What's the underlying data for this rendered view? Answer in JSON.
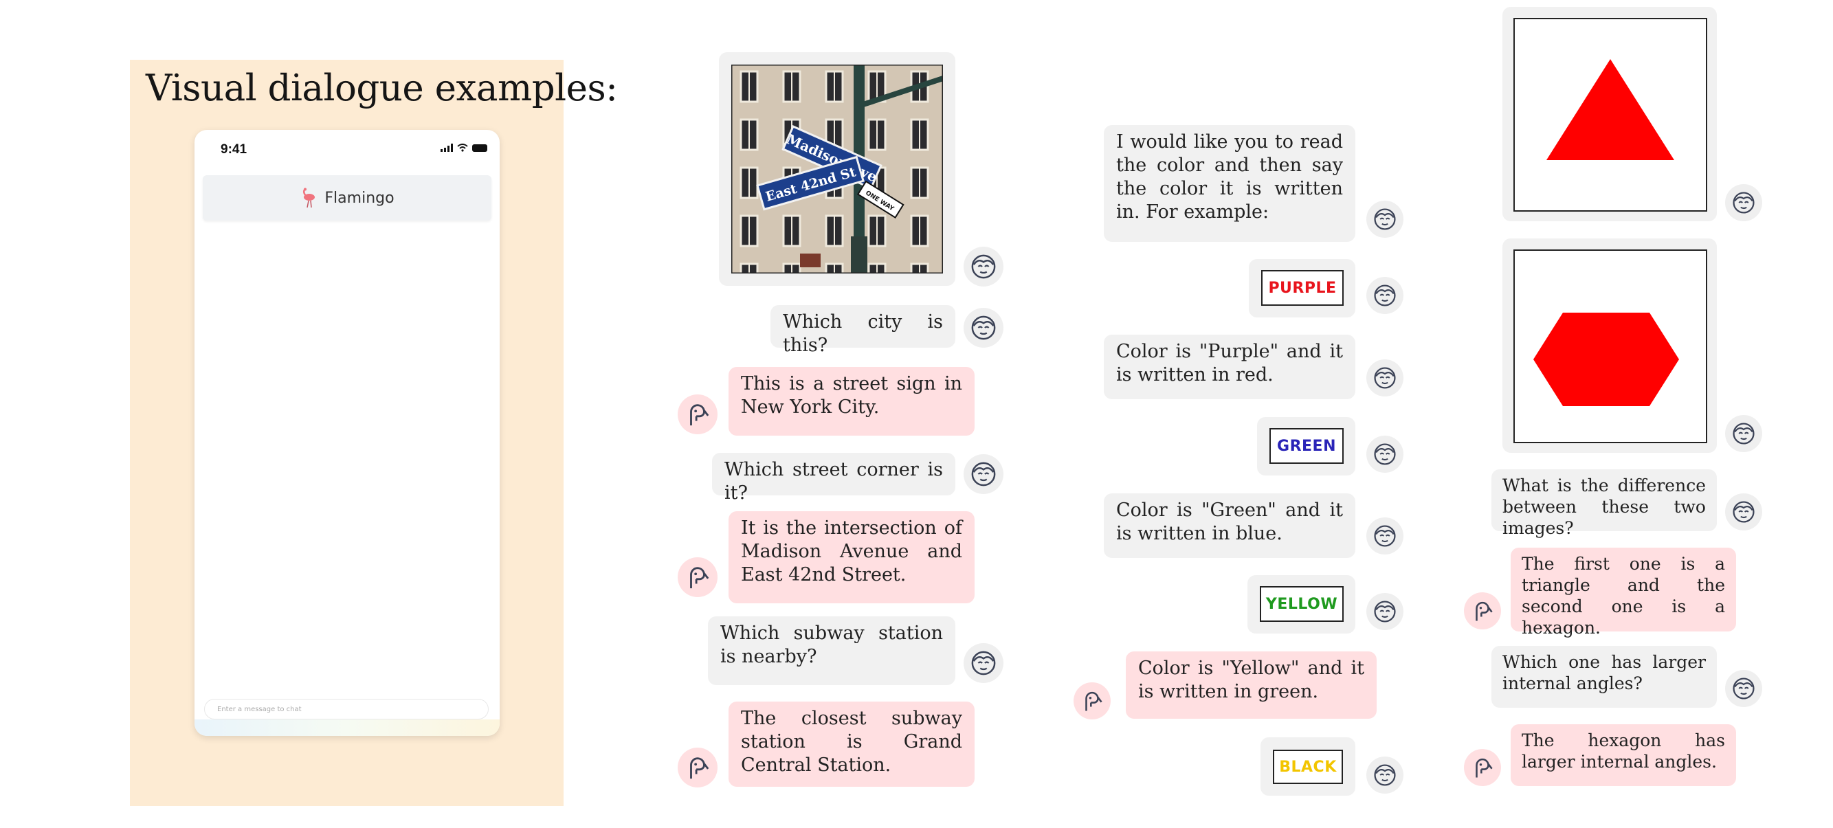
{
  "title": "Visual dialogue examples:",
  "phone": {
    "time": "9:41",
    "app_name": "Flamingo",
    "input_placeholder": "Enter a message to chat"
  },
  "conversation_1": {
    "image": "street-sign-photo",
    "street_signs": [
      "Madison Ave",
      "East 42nd St",
      "ONE WAY"
    ],
    "messages": [
      {
        "role": "user",
        "text": "Which city is this?"
      },
      {
        "role": "bot",
        "text": "This is a street sign in New York City."
      },
      {
        "role": "user",
        "text": "Which street corner is it?"
      },
      {
        "role": "bot",
        "text": "It is the intersection of Madison Avenue and East 42nd Street."
      },
      {
        "role": "user",
        "text": "Which subway station is nearby?"
      },
      {
        "role": "bot",
        "text": "The closest subway station is Grand Central Station."
      }
    ]
  },
  "conversation_2": {
    "prompt": "I would like you to read the color and then say the color it is written in. For example:",
    "examples": [
      {
        "word": "PURPLE",
        "ink": "#e8141c"
      },
      {
        "word": "GREEN",
        "ink": "#2a24b8"
      },
      {
        "word": "YELLOW",
        "ink": "#1f9a1f"
      },
      {
        "word": "BLACK",
        "ink": "#f2c500"
      }
    ],
    "answers": [
      {
        "role": "user",
        "text": "Color is \"Purple\" and it is written in red."
      },
      {
        "role": "user",
        "text": "Color is \"Green\" and it is written in blue."
      },
      {
        "role": "bot",
        "text": "Color is \"Yellow\" and it is written in green."
      }
    ]
  },
  "conversation_3": {
    "shape_color": "#ff0000",
    "messages": [
      {
        "role": "user",
        "text": "What is the difference between these two images?"
      },
      {
        "role": "bot",
        "text": "The first one is a triangle and the second one is a hexagon."
      },
      {
        "role": "user",
        "text": "Which one has larger internal angles?"
      },
      {
        "role": "bot",
        "text": "The hexagon has larger internal angles."
      }
    ]
  }
}
